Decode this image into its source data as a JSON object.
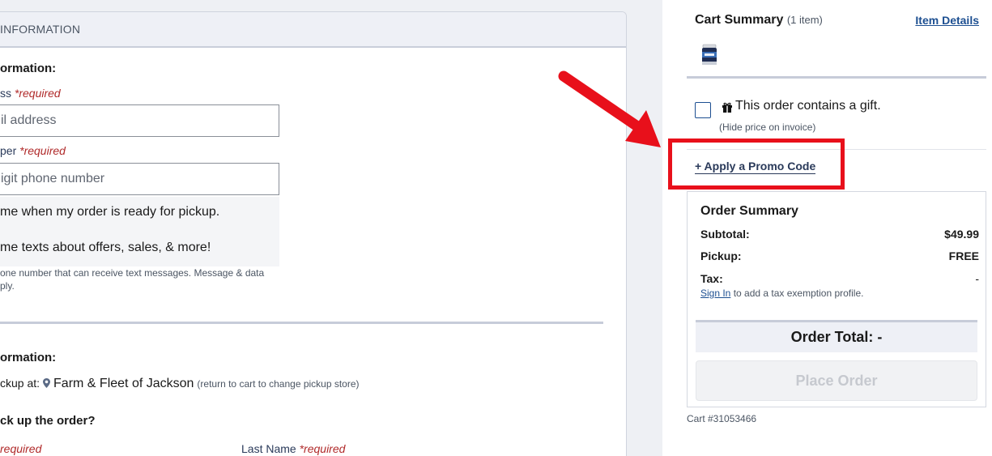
{
  "checkout": {
    "section_header": "INFORMATION",
    "contact_title": "ormation:",
    "email": {
      "label": "ss",
      "required": "*required",
      "placeholder": "il address"
    },
    "phone": {
      "label": "per",
      "required": "*required",
      "placeholder": "igit phone number"
    },
    "sms_options": [
      "me when my order is ready for pickup.",
      "me texts about offers, sales, & more!"
    ],
    "sms_disclaimer": "one number that can receive text messages. Message & data\nply.",
    "pickup_title": "ormation:",
    "pickup_prefix": "ckup at:",
    "pickup_store": "Farm & Fleet of Jackson",
    "pickup_hint": "(return to cart to change pickup store)",
    "who_title": "ck up the order?",
    "first_required": "required",
    "last_name": {
      "label": "Last Name",
      "required": "*required"
    }
  },
  "cart": {
    "title": "Cart Summary",
    "item_count": "(1 item)",
    "item_details_link": "Item Details",
    "gift_label": "This order contains a gift.",
    "gift_sub": "(Hide price on invoice)",
    "promo_link": "+ Apply a Promo Code",
    "order_summary": {
      "title": "Order Summary",
      "rows": [
        {
          "label": "Subtotal:",
          "value": "$49.99"
        },
        {
          "label": "Pickup:",
          "value": "FREE"
        },
        {
          "label": "Tax:",
          "value": "-"
        }
      ],
      "sign_in_link": "Sign In",
      "sign_in_note": "to add a tax exemption profile.",
      "total": "Order Total: -",
      "place_order": "Place Order"
    },
    "cart_number": "Cart #31053466"
  },
  "colors": {
    "annotation_red": "#e8101b",
    "link_blue": "#1d4f91",
    "required_red": "#b02a2a"
  }
}
